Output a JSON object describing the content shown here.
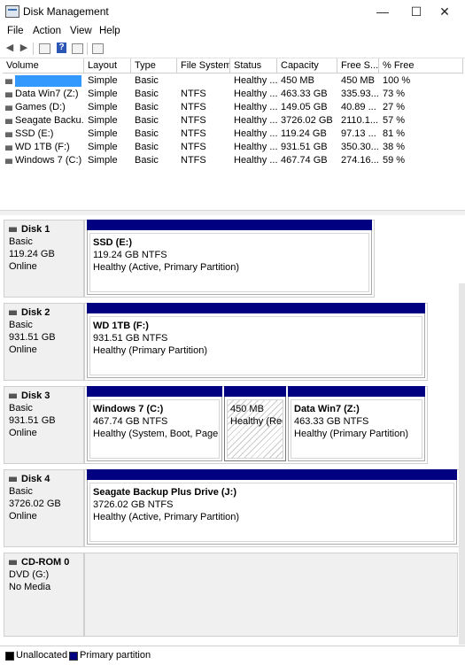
{
  "window": {
    "title": "Disk Management",
    "controls": {
      "minimize": "—",
      "maximize": "☐",
      "close": "✕"
    }
  },
  "menu": [
    "File",
    "Action",
    "View",
    "Help"
  ],
  "toolbar": {
    "icons": [
      "back-arrow-icon",
      "forward-arrow-icon",
      "properties-icon",
      "help-icon",
      "show-hide-icon",
      "console-tree-icon"
    ],
    "help_glyph": "?"
  },
  "volume_list": {
    "columns": [
      "Volume",
      "Layout",
      "Type",
      "File System",
      "Status",
      "Capacity",
      "Free S...",
      "% Free"
    ],
    "rows": [
      {
        "volume": "",
        "layout": "Simple",
        "type": "Basic",
        "fs": "",
        "status": "Healthy ...",
        "capacity": "450 MB",
        "free": "450 MB",
        "pct": "100 %",
        "selected": true
      },
      {
        "volume": "Data Win7 (Z:)",
        "layout": "Simple",
        "type": "Basic",
        "fs": "NTFS",
        "status": "Healthy ...",
        "capacity": "463.33 GB",
        "free": "335.93...",
        "pct": "73 %"
      },
      {
        "volume": "Games (D:)",
        "layout": "Simple",
        "type": "Basic",
        "fs": "NTFS",
        "status": "Healthy ...",
        "capacity": "149.05 GB",
        "free": "40.89 ...",
        "pct": "27 %"
      },
      {
        "volume": "Seagate Backu...",
        "layout": "Simple",
        "type": "Basic",
        "fs": "NTFS",
        "status": "Healthy ...",
        "capacity": "3726.02 GB",
        "free": "2110.1...",
        "pct": "57 %"
      },
      {
        "volume": "SSD (E:)",
        "layout": "Simple",
        "type": "Basic",
        "fs": "NTFS",
        "status": "Healthy ...",
        "capacity": "119.24 GB",
        "free": "97.13 ...",
        "pct": "81 %"
      },
      {
        "volume": "WD 1TB (F:)",
        "layout": "Simple",
        "type": "Basic",
        "fs": "NTFS",
        "status": "Healthy ...",
        "capacity": "931.51 GB",
        "free": "350.30...",
        "pct": "38 %"
      },
      {
        "volume": "Windows 7 (C:)",
        "layout": "Simple",
        "type": "Basic",
        "fs": "NTFS",
        "status": "Healthy ...",
        "capacity": "467.74 GB",
        "free": "274.16...",
        "pct": "59 %"
      }
    ]
  },
  "disks": [
    {
      "name": "Disk 1",
      "lines": [
        "Basic",
        "119.24 GB",
        "Online"
      ],
      "partitions": [
        {
          "title": "SSD  (E:)",
          "size": "119.24 GB NTFS",
          "status": "Healthy (Active, Primary Partition)"
        }
      ]
    },
    {
      "name": "Disk 2",
      "lines": [
        "Basic",
        "931.51 GB",
        "Online"
      ],
      "partitions": [
        {
          "title": "WD 1TB  (F:)",
          "size": "931.51 GB NTFS",
          "status": "Healthy (Primary Partition)"
        }
      ]
    },
    {
      "name": "Disk 3",
      "lines": [
        "Basic",
        "931.51 GB",
        "Online"
      ],
      "partitions": [
        {
          "title": "Windows 7  (C:)",
          "size": "467.74 GB NTFS",
          "status": "Healthy (System, Boot, Page Fi"
        },
        {
          "title": "",
          "size": "450 MB",
          "status": "Healthy (Rec"
        },
        {
          "title": "Data Win7  (Z:)",
          "size": "463.33 GB NTFS",
          "status": "Healthy (Primary Partition)"
        }
      ]
    },
    {
      "name": "Disk 4",
      "lines": [
        "Basic",
        "3726.02 GB",
        "Online"
      ],
      "partitions": [
        {
          "title": "Seagate Backup Plus Drive  (J:)",
          "size": "3726.02 GB NTFS",
          "status": "Healthy (Active, Primary Partition)"
        }
      ]
    },
    {
      "name": "CD-ROM 0",
      "lines": [
        "DVD (G:)",
        "",
        "No Media"
      ],
      "partitions": []
    }
  ],
  "legend": [
    {
      "label": "Unallocated",
      "color": "#000000"
    },
    {
      "label": "Primary partition",
      "color": "#000080"
    }
  ]
}
